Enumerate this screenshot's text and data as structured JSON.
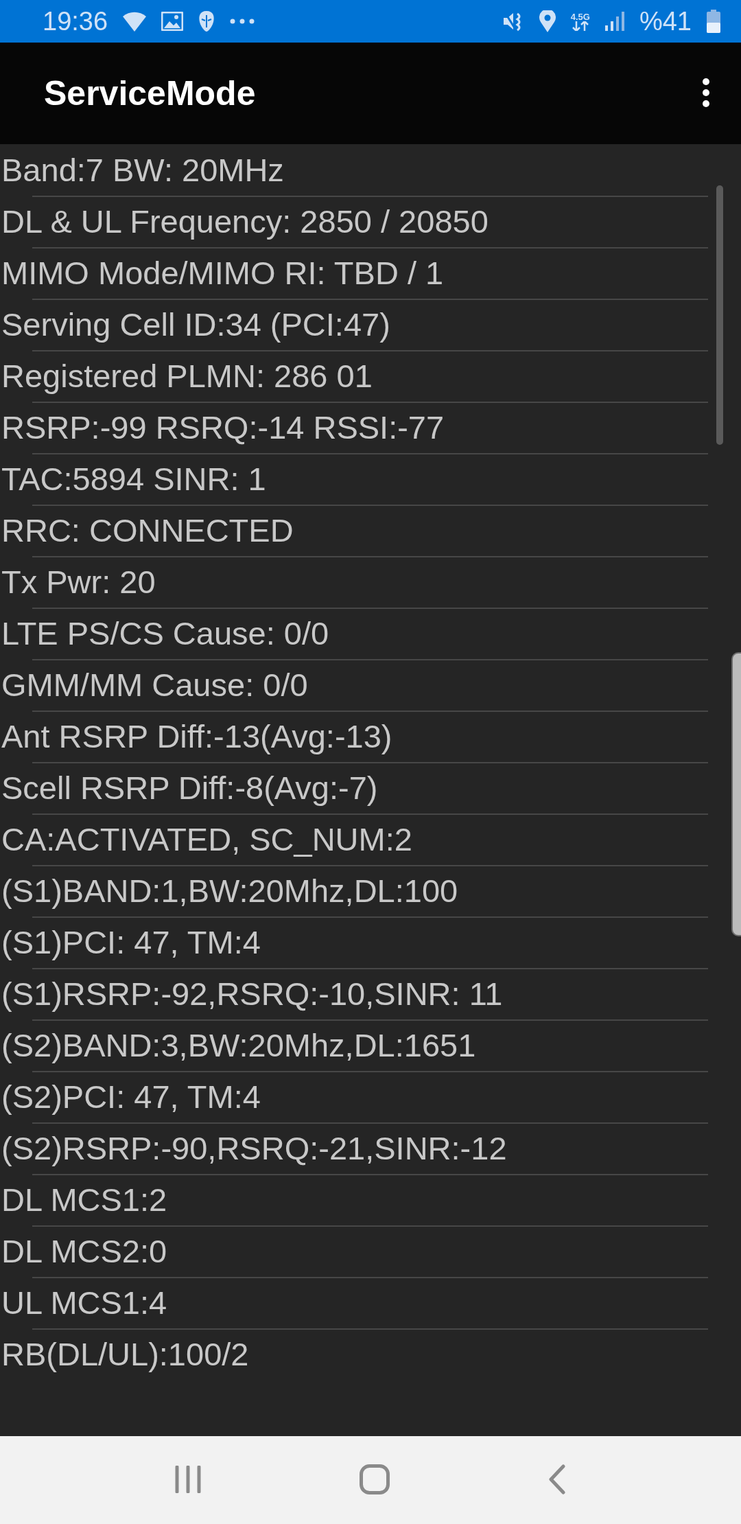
{
  "status_bar": {
    "time": "19:36",
    "network_type": "4.5G",
    "battery": "%41"
  },
  "app_bar": {
    "title": "ServiceMode"
  },
  "lines": [
    "Band:7 BW: 20MHz",
    "DL & UL Frequency: 2850 / 20850",
    "MIMO Mode/MIMO RI: TBD / 1",
    "Serving Cell ID:34 (PCI:47)",
    "Registered PLMN: 286 01",
    "RSRP:-99 RSRQ:-14 RSSI:-77",
    "TAC:5894 SINR: 1",
    "RRC: CONNECTED",
    "Tx Pwr: 20",
    "LTE PS/CS Cause: 0/0",
    "GMM/MM Cause: 0/0",
    "Ant RSRP Diff:-13(Avg:-13)",
    "Scell RSRP Diff:-8(Avg:-7)",
    "CA:ACTIVATED, SC_NUM:2",
    "(S1)BAND:1,BW:20Mhz,DL:100",
    "(S1)PCI: 47, TM:4",
    "(S1)RSRP:-92,RSRQ:-10,SINR: 11",
    "(S2)BAND:3,BW:20Mhz,DL:1651",
    "(S2)PCI: 47, TM:4",
    "(S2)RSRP:-90,RSRQ:-21,SINR:-12",
    "DL MCS1:2",
    "DL MCS2:0",
    "UL MCS1:4",
    "RB(DL/UL):100/2"
  ]
}
